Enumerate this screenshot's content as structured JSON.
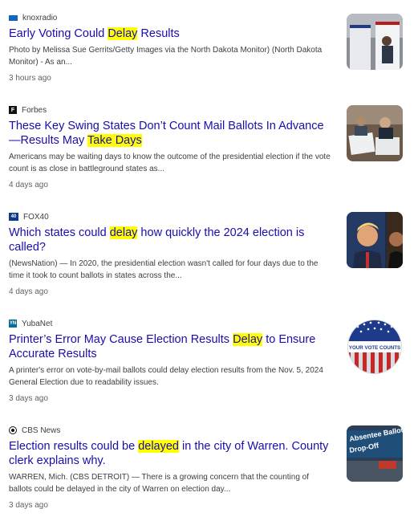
{
  "results": [
    {
      "source": "knoxradio",
      "source_icon": "knoxradio-logo",
      "title_parts": [
        "Early Voting Could ",
        "Delay",
        " Results"
      ],
      "snippet": "Photo by Melissa Sue Gerrits/Getty Images via the North Dakota Monitor) (North Dakota Monitor) - As an...",
      "time": "3 hours ago",
      "thumb": "voting-booths-image"
    },
    {
      "source": "Forbes",
      "source_icon": "forbes-logo",
      "title_parts": [
        "These Key Swing States Don’t Count Mail Ballots In Advance —Results May ",
        "Take Days"
      ],
      "snippet": "Americans may be waiting days to know the outcome of the presidential election if the vote count is as close in battleground states as...",
      "time": "4 days ago",
      "thumb": "ballot-counting-image"
    },
    {
      "source": "FOX40",
      "source_icon": "fox40-logo",
      "title_parts": [
        "Which states could ",
        "delay",
        " how quickly the 2024 election is called?"
      ],
      "snippet": "(NewsNation) — In 2020, the presidential election wasn't called for four days due to the time it took to count ballots in states across the...",
      "time": "4 days ago",
      "thumb": "candidates-image"
    },
    {
      "source": "YubaNet",
      "source_icon": "yubanet-logo",
      "title_parts": [
        "Printer’s Error May Cause Election Results ",
        "Delay",
        " to Ensure Accurate Results"
      ],
      "snippet": "A printer's error on vote-by-mail ballots could delay election results from the Nov. 5, 2024 General Election due to readability issues.",
      "time": "3 days ago",
      "thumb": "your-vote-counts-image",
      "thumb_text": "YOUR VOTE COUNTS"
    },
    {
      "source": "CBS News",
      "source_icon": "cbs-logo",
      "title_parts": [
        "Election results could be ",
        "delayed",
        " in the city of Warren. County clerk explains why."
      ],
      "snippet": "WARREN, Mich. (CBS DETROIT) — There is a growing concern that the counting of ballots could be delayed in the city of Warren on election day...",
      "time": "3 days ago",
      "thumb": "absentee-ballot-dropoff-image",
      "thumb_text_1": "Absentee Ballot",
      "thumb_text_2": "Drop-Off"
    }
  ],
  "colors": {
    "title": "#1a0dab",
    "highlight": "#ffff00",
    "snippet": "#3c4043",
    "time": "#5f6368"
  }
}
